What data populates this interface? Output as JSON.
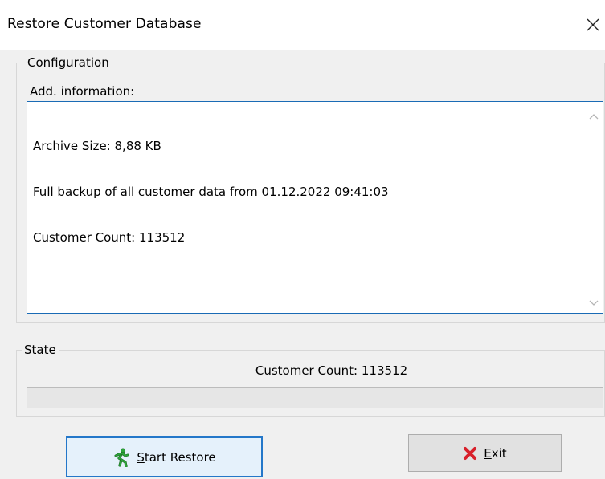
{
  "window": {
    "title": "Restore Customer Database"
  },
  "configuration": {
    "group_label": "Configuration",
    "addinfo_label": "Add. information:",
    "lines": [
      "Archive Size: 8,88 KB",
      "Full backup of all customer data from 01.12.2022 09:41:03",
      "Customer Count: 113512"
    ]
  },
  "state": {
    "group_label": "State",
    "status_text": "Customer Count: 113512",
    "progress_fraction": 0
  },
  "buttons": {
    "start": {
      "mnemonic": "S",
      "rest": "tart Restore"
    },
    "exit": {
      "mnemonic": "E",
      "rest": "xit"
    }
  },
  "colors": {
    "accent": "#2477c9",
    "exit_icon": "#d8202a",
    "start_icon": "#2ea53a"
  }
}
